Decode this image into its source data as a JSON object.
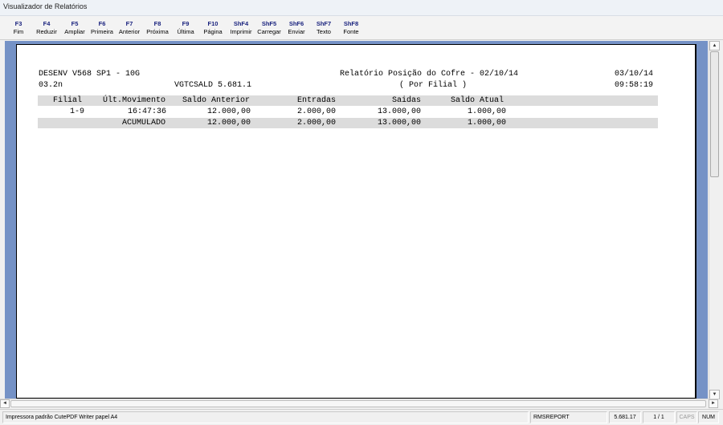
{
  "window": {
    "title": "Visualizador de Relatórios"
  },
  "toolbar": [
    {
      "key": "F3",
      "label": "Fim"
    },
    {
      "key": "F4",
      "label": "Reduzir"
    },
    {
      "key": "F5",
      "label": "Ampliar"
    },
    {
      "key": "F6",
      "label": "Primeira"
    },
    {
      "key": "F7",
      "label": "Anterior"
    },
    {
      "key": "F8",
      "label": "Próxima"
    },
    {
      "key": "F9",
      "label": "Última"
    },
    {
      "key": "F10",
      "label": "Página"
    },
    {
      "key": "ShF4",
      "label": "Imprimir"
    },
    {
      "key": "ShF5",
      "label": "Carregar"
    },
    {
      "key": "ShF6",
      "label": "Enviar"
    },
    {
      "key": "ShF7",
      "label": "Texto"
    },
    {
      "key": "ShF8",
      "label": "Fonte"
    }
  ],
  "report": {
    "header": {
      "system": "DESENV V568 SP1 - 10G",
      "title": "Relatório Posição do Cofre - 02/10/14",
      "date": "03/10/14",
      "version_code": "03.2n",
      "program": "VGTCSALD 5.681.1",
      "subtitle": "( Por Filial )",
      "time": "09:58:19"
    },
    "columns": [
      "Filial",
      "Últ.Movimento",
      "Saldo Anterior",
      "Entradas",
      "Saidas",
      "Saldo Atual"
    ],
    "rows": [
      [
        "1-9",
        "16:47:36",
        "12.000,00",
        "2.000,00",
        "13.000,00",
        "1.000,00"
      ]
    ],
    "totals": {
      "label": "ACUMULADO",
      "saldo_anterior": "12.000,00",
      "entradas": "2.000,00",
      "saidas": "13.000,00",
      "saldo_atual": "1.000,00"
    }
  },
  "scroll": {
    "up_arrow": "▲",
    "down_arrow": "▼",
    "left_arrow": "◄",
    "right_arrow": "►"
  },
  "statusbar": {
    "printer": "Impressora padrão CutePDF Writer papel A4",
    "module": "RMSREPORT",
    "version": "5.681.17",
    "page": "1 / 1",
    "caps": "CAPS",
    "num": "NUM"
  }
}
